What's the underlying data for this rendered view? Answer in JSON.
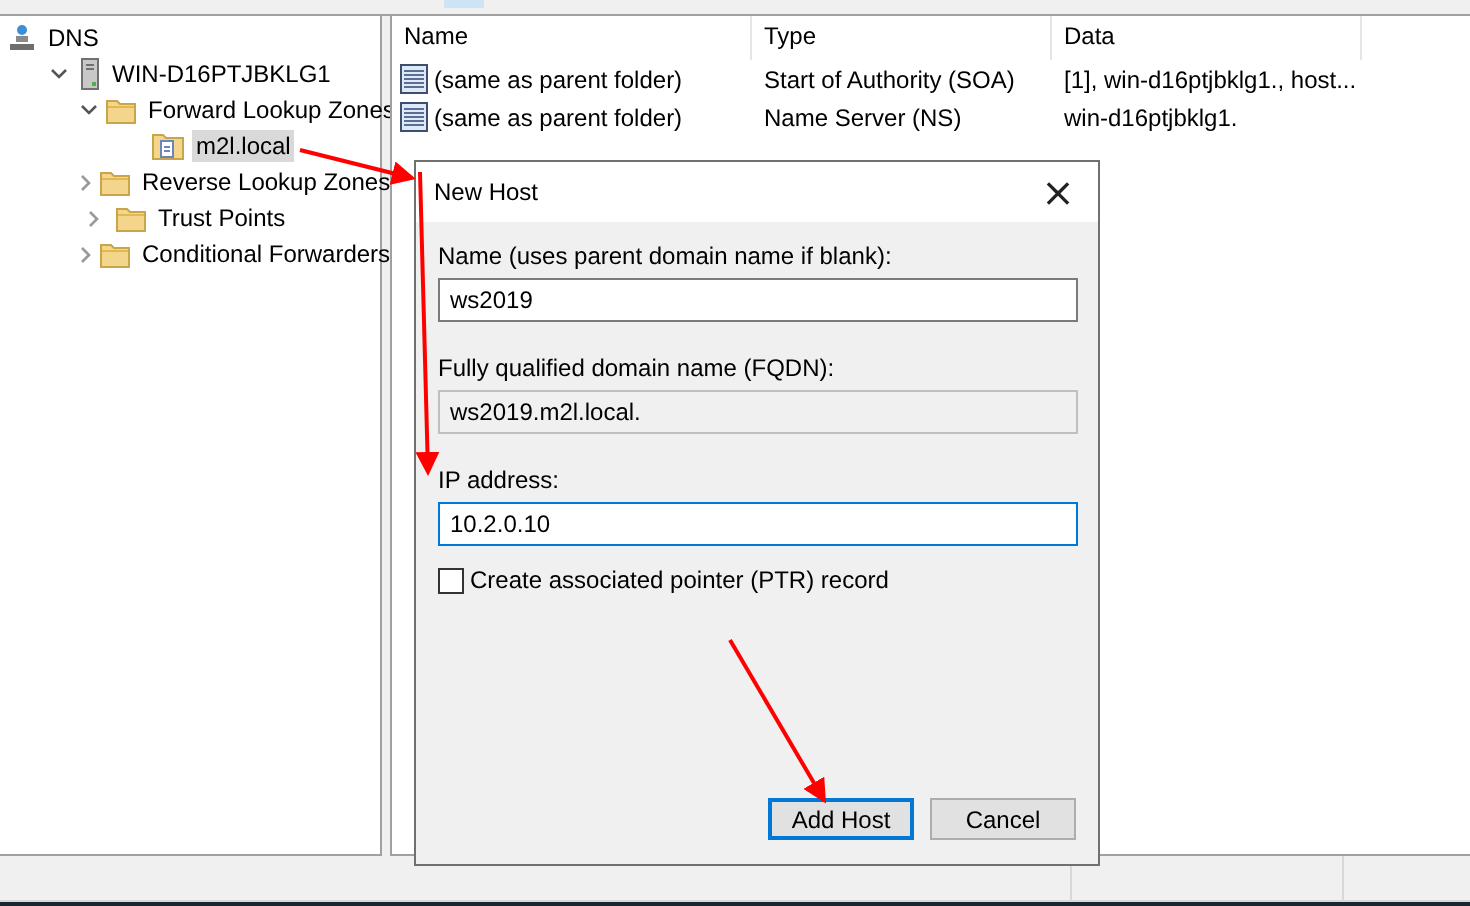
{
  "tree": [
    {
      "label": "DNS",
      "kind": "dns",
      "selected": false,
      "children": [
        {
          "label": "WIN-D16PTJBKLG1",
          "kind": "server",
          "expanded": true,
          "selected": false,
          "children": [
            {
              "label": "Forward Lookup Zones",
              "kind": "folder",
              "expanded": true,
              "selected": false,
              "children": [
                {
                  "label": "m2l.local",
                  "kind": "zone",
                  "selected": true
                }
              ]
            },
            {
              "label": "Reverse Lookup Zones",
              "kind": "folder",
              "expanded": false,
              "selected": false
            },
            {
              "label": "Trust Points",
              "kind": "folder",
              "expanded": false,
              "selected": false
            },
            {
              "label": "Conditional Forwarders",
              "kind": "folder",
              "expanded": false,
              "selected": false
            }
          ]
        }
      ]
    }
  ],
  "list": {
    "columns": [
      "Name",
      "Type",
      "Data"
    ],
    "rows": [
      {
        "cells": [
          "(same as parent folder)",
          "Start of Authority (SOA)",
          "[1], win-d16ptjbklg1., host..."
        ]
      },
      {
        "cells": [
          "(same as parent folder)",
          "Name Server (NS)",
          "win-d16ptjbklg1."
        ]
      }
    ]
  },
  "dialog": {
    "title": "New Host",
    "close": "×",
    "fields": [
      {
        "label": "Name (uses parent domain name if blank):",
        "value": "ws2019",
        "disabled": false,
        "focused": false
      },
      {
        "label": "Fully qualified domain name (FQDN):",
        "value": "ws2019.m2l.local.",
        "disabled": true,
        "focused": false
      },
      {
        "label": "IP address:",
        "value": "10.2.0.10",
        "disabled": false,
        "focused": true
      }
    ],
    "checkbox": {
      "label": "Create associated pointer (PTR) record",
      "checked": false
    },
    "buttons": [
      {
        "label": "Add Host",
        "default": true
      },
      {
        "label": "Cancel",
        "default": false
      }
    ]
  }
}
